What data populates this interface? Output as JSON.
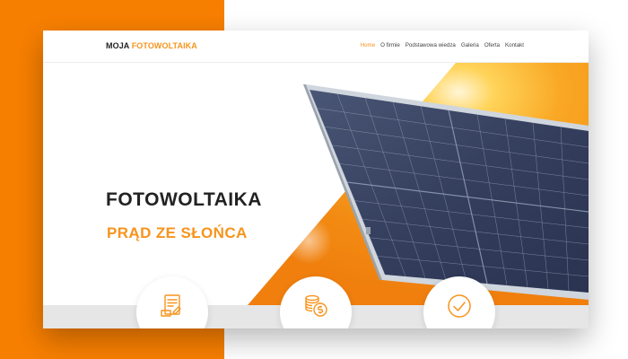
{
  "brand": {
    "part1": "MOJA",
    "part2": "FOTOWOLTAIKA"
  },
  "nav": {
    "items": [
      "Home",
      "O firmie",
      "Podstawowa wiedza",
      "Galeria",
      "Oferta",
      "Kontakt"
    ],
    "active": "Home"
  },
  "hero": {
    "title": "FOTOWOLTAIKA",
    "subtitle": "PRĄD ZE SŁOŃCA"
  },
  "features": [
    {
      "icon": "document-contract-icon"
    },
    {
      "icon": "coins-dollar-icon"
    },
    {
      "icon": "check-circle-icon"
    }
  ],
  "colors": {
    "accent": "#f7941d",
    "background_orange": "#f77f00",
    "dark_text": "#222222",
    "panel_cell": "#3c4768"
  }
}
